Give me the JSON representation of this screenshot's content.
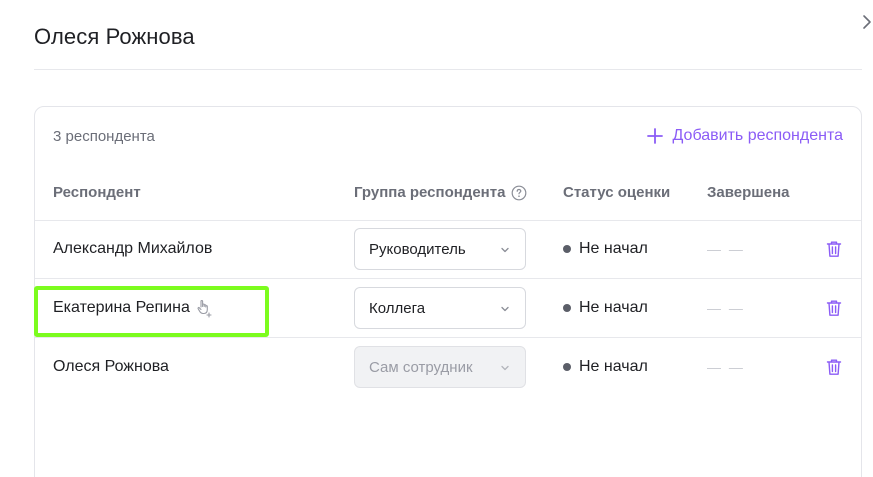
{
  "panel": {
    "title": "Олеся Рожнова",
    "close_icon": "chevron-right-icon"
  },
  "card": {
    "count_label": "3 респондента",
    "add_button_label": "Добавить респондента",
    "accent_color": "#8b5cf6",
    "columns": {
      "respondent": "Респондент",
      "group": "Группа респондента",
      "status": "Статус оценки",
      "completed": "Завершена"
    },
    "rows": [
      {
        "name": "Александр Михайлов",
        "group": "Руководитель",
        "group_disabled": false,
        "status": "Не начал",
        "completed": "— —"
      },
      {
        "name": "Екатерина Репина",
        "group": "Коллега",
        "group_disabled": false,
        "status": "Не начал",
        "completed": "— —"
      },
      {
        "name": "Олеся Рожнова",
        "group": "Сам сотрудник",
        "group_disabled": true,
        "status": "Не начал",
        "completed": "— —"
      }
    ]
  },
  "highlight_color": "#7cfc1e"
}
